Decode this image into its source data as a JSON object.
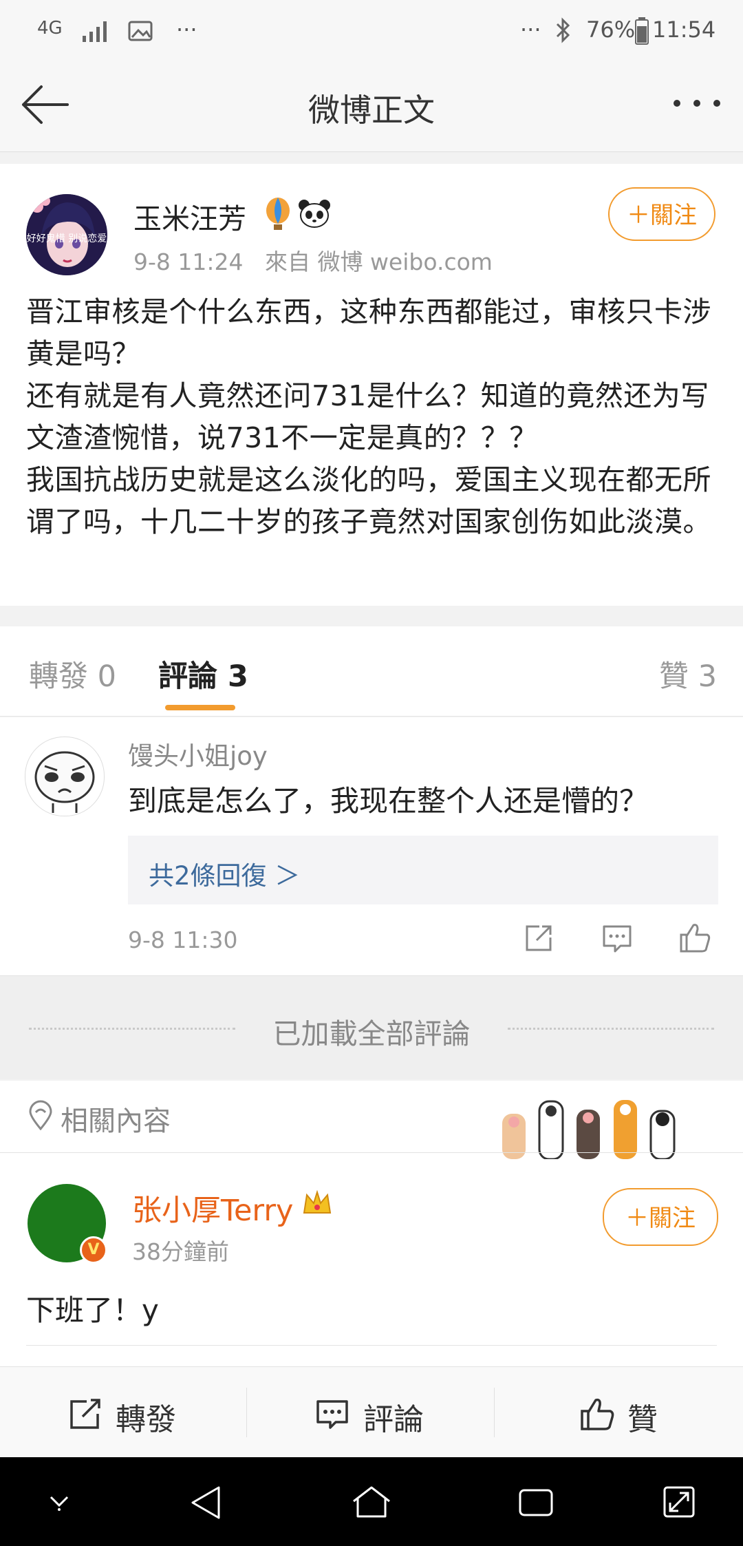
{
  "status_bar": {
    "network": "4G",
    "more": "···",
    "battery": "76%",
    "time": "11:54"
  },
  "nav": {
    "title": "微博正文",
    "back_icon": "arrow-left-icon",
    "more_icon": "more-dots-icon"
  },
  "post": {
    "author": "玉米汪芳",
    "avatar_text": "好好鬼惜 别说恋爱",
    "meta": "9-8 11:24   來自 微博 weibo.com",
    "follow_label": "＋關注",
    "text": "晋江审核是个什么东西，这种东西都能过，审核只卡涉黄是吗？\n还有就是有人竟然还问731是什么？知道的竟然还为写文渣渣惋惜，说731不一定是真的？？？\n我国抗战历史就是这么淡化的吗，爱国主义现在都无所谓了吗，十几二十岁的孩子竟然对国家创伤如此淡漠。"
  },
  "tabs": {
    "repost": "轉發 0",
    "comments": "評論 3",
    "likes": "贊 3"
  },
  "comment": {
    "author": "馒头小姐joy",
    "text": "到底是怎么了，我现在整个人还是懵的？",
    "replies": "共2條回復 ＞",
    "time": "9-8 11:30"
  },
  "loaded_all": "已加載全部評論",
  "related": {
    "title": "相關內容",
    "item": {
      "author": "张小厚Terry",
      "time": "38分鐘前",
      "follow_label": "＋關注",
      "text": "下班了！y",
      "verified_badge": "V"
    }
  },
  "actions": {
    "repost": "轉發",
    "comment": "評論",
    "like": "贊"
  },
  "colors": {
    "accent": "#f08a14",
    "link": "#3d6a9c",
    "related_author": "#e8631a"
  }
}
